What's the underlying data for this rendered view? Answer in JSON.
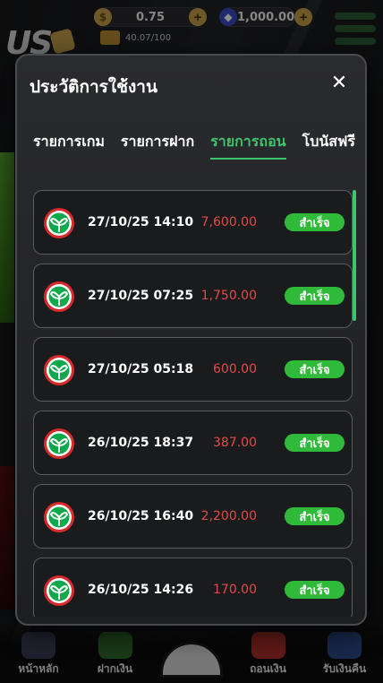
{
  "header": {
    "balance": "0.75",
    "points": "1,000.00",
    "level_progress": "40.07/100",
    "brand": "US"
  },
  "bottom_nav": [
    {
      "label": "หน้าหลัก",
      "icon": "home-icon"
    },
    {
      "label": "ฝากเงิน",
      "icon": "deposit-icon"
    },
    {
      "label": "",
      "icon": "center-ball-icon"
    },
    {
      "label": "ถอนเงิน",
      "icon": "withdraw-icon"
    },
    {
      "label": "รับเงินคืน",
      "icon": "cashback-icon"
    }
  ],
  "modal": {
    "title": "ประวัติการใช้งาน",
    "close_icon": "close-icon",
    "tabs": [
      {
        "label": "รายการเกม",
        "active": false
      },
      {
        "label": "รายการฝาก",
        "active": false
      },
      {
        "label": "รายการถอน",
        "active": true
      },
      {
        "label": "โบนัสฟรี",
        "active": false
      }
    ],
    "transactions": [
      {
        "date": "27/10/25 14:10",
        "amount": "7,600.00",
        "status": "สำเร็จ",
        "bank_icon": "kbank-icon"
      },
      {
        "date": "27/10/25 07:25",
        "amount": "1,750.00",
        "status": "สำเร็จ",
        "bank_icon": "kbank-icon"
      },
      {
        "date": "27/10/25 05:18",
        "amount": "600.00",
        "status": "สำเร็จ",
        "bank_icon": "kbank-icon"
      },
      {
        "date": "26/10/25 18:37",
        "amount": "387.00",
        "status": "สำเร็จ",
        "bank_icon": "kbank-icon"
      },
      {
        "date": "26/10/25 16:40",
        "amount": "2,200.00",
        "status": "สำเร็จ",
        "bank_icon": "kbank-icon"
      },
      {
        "date": "26/10/25 14:26",
        "amount": "170.00",
        "status": "สำเร็จ",
        "bank_icon": "kbank-icon"
      }
    ]
  },
  "colors": {
    "accent_green": "#3ec46d",
    "status_green": "#2fba3a",
    "amount_red": "#e24a4a"
  }
}
